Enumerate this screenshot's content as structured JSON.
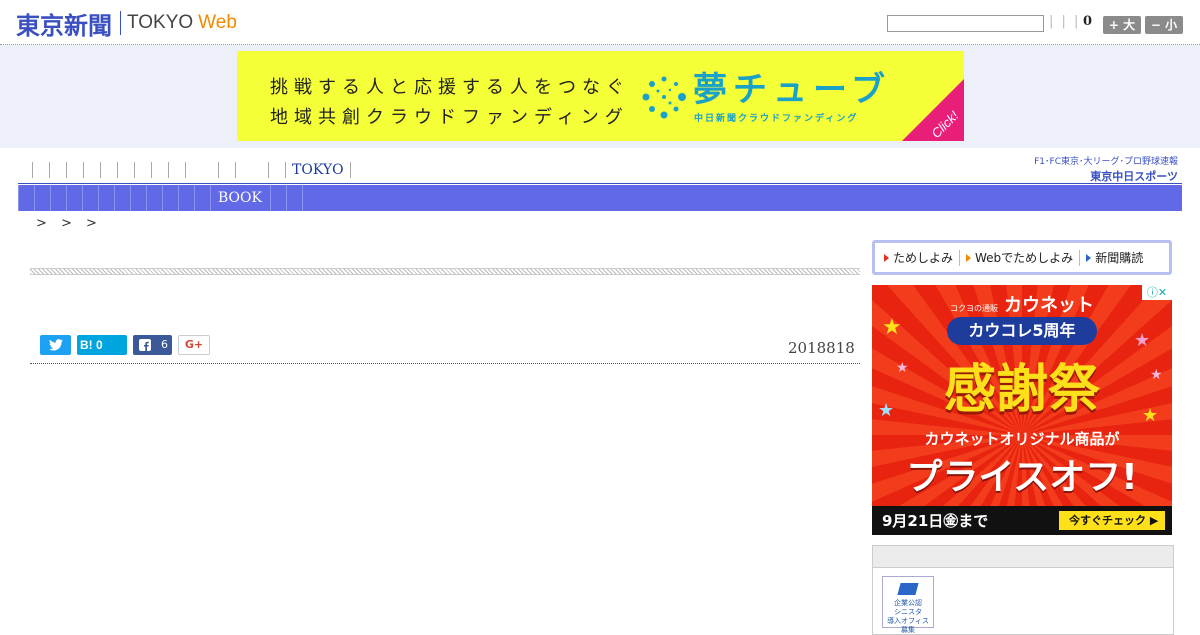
{
  "header": {
    "logo_jp": "東京新聞",
    "logo_en": "TOKYO",
    "logo_web": "Web",
    "separators": "| | |",
    "count": "0",
    "font_up": "+ 大",
    "font_down": "− 小"
  },
  "banner": {
    "line1": "挑戦する人と応援する人をつなぐ",
    "line2": "地域共創クラウドファンディング",
    "brand": "夢チューブ",
    "brand_sub": "中日新聞クラウドファンディング",
    "click": "Click!"
  },
  "nav": {
    "tokyo": "TOKYO",
    "book": "BOOK",
    "sports_line1": "F1･FC東京･大リーグ･プロ野球速報",
    "sports_line2": "東京中日スポーツ"
  },
  "breadcrumb": ">   > >",
  "social": {
    "hatena": "B! 0",
    "facebook_count": "6",
    "gplus": "G+"
  },
  "article": {
    "date": "2018818"
  },
  "sidebar": {
    "tabs": [
      "ためしよみ",
      "Webでためしよみ",
      "新聞購読"
    ],
    "ad": {
      "brand_small": "コクヨの通販",
      "brand": "カウネット",
      "pill": "カウコレ5周年",
      "headline": "感謝祭",
      "mid": "カウネットオリジナル商品が",
      "price": "プライスオフ!",
      "date": "9月21日㊎まで",
      "cta": "今すぐチェック ▶",
      "info": "ⓘ✕"
    },
    "panel_logo": "企業公認\nシニスタ\n導入オフィス\n募集"
  },
  "colors": {
    "brand_blue": "#3a50c0",
    "nav_bar": "#6169e6",
    "banner_bg": "#f5ff37",
    "banner_accent": "#1aa1c9",
    "ad_red": "#e81e13"
  }
}
